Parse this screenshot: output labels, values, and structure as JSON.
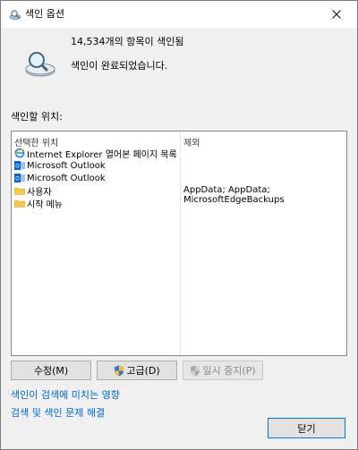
{
  "window": {
    "title": "색인 옵션"
  },
  "status": {
    "count_text": "14,534개의 항목이 색인됨",
    "message": "색인이 완료되었습니다."
  },
  "locations": {
    "label": "색인할 위치:",
    "columns": {
      "selected": "선택한 위치",
      "exclude": "제외"
    },
    "items": [
      {
        "name": "Internet Explorer 열어본 페이지 목록",
        "icon": "ie-history-icon",
        "exclude": ""
      },
      {
        "name": "Microsoft Outlook",
        "icon": "outlook-icon",
        "exclude": ""
      },
      {
        "name": "Microsoft Outlook",
        "icon": "outlook-icon",
        "exclude": ""
      },
      {
        "name": "사용자",
        "icon": "folder-icon",
        "exclude": "AppData; AppData; MicrosoftEdgeBackups"
      },
      {
        "name": "시작 메뉴",
        "icon": "folder-icon",
        "exclude": ""
      }
    ]
  },
  "buttons": {
    "modify": "수정(M)",
    "advanced": "고급(D)",
    "pause": "일시 중지(P)",
    "close": "닫기"
  },
  "links": {
    "impact": "색인이 검색에 미치는 영향",
    "troubleshoot": "검색 및 색인 문제 해결"
  },
  "colors": {
    "link": "#0066cc",
    "outlook_blue": "#0a64c4",
    "folder_yellow": "#f2c94c",
    "focus_border": "#0078d7"
  }
}
